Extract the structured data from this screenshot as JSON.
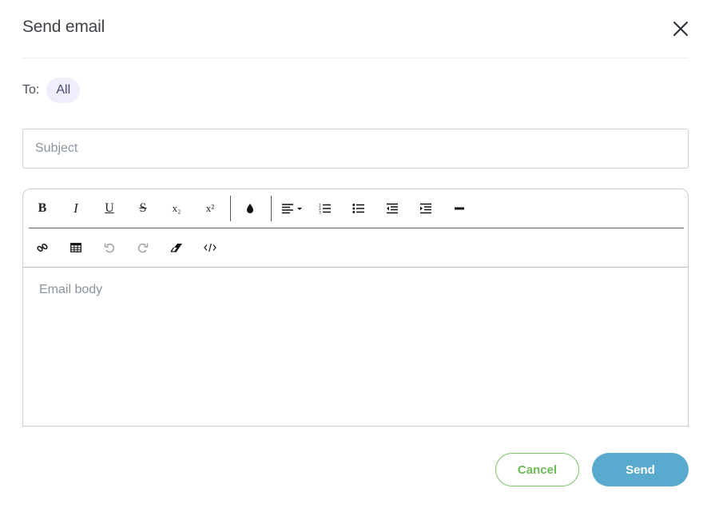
{
  "dialog": {
    "title": "Send email",
    "close_icon": "close-icon"
  },
  "recipients": {
    "label": "To:",
    "chip": "All"
  },
  "subject": {
    "placeholder": "Subject",
    "value": ""
  },
  "editor": {
    "body_placeholder": "Email body",
    "toolbar_row1": [
      {
        "name": "bold-icon",
        "glyph": "B"
      },
      {
        "name": "italic-icon",
        "glyph": "I"
      },
      {
        "name": "underline-icon",
        "glyph": "U"
      },
      {
        "name": "strikethrough-icon",
        "glyph": "S"
      },
      {
        "name": "subscript-icon",
        "glyph": "x₂"
      },
      {
        "name": "superscript-icon",
        "glyph": "x²"
      },
      {
        "name": "text-color-icon"
      },
      {
        "name": "align-dropdown-icon"
      },
      {
        "name": "ordered-list-icon"
      },
      {
        "name": "bullet-list-icon"
      },
      {
        "name": "outdent-icon"
      },
      {
        "name": "indent-icon"
      },
      {
        "name": "horizontal-rule-icon"
      }
    ],
    "toolbar_row2": [
      {
        "name": "link-icon"
      },
      {
        "name": "table-icon"
      },
      {
        "name": "undo-icon"
      },
      {
        "name": "redo-icon"
      },
      {
        "name": "clear-format-icon"
      },
      {
        "name": "code-view-icon"
      }
    ]
  },
  "actions": {
    "cancel_label": "Cancel",
    "send_label": "Send"
  },
  "colors": {
    "chip_bg": "#efeefb",
    "cancel_accent": "#6cbc56",
    "send_bg": "#5aaad0"
  }
}
